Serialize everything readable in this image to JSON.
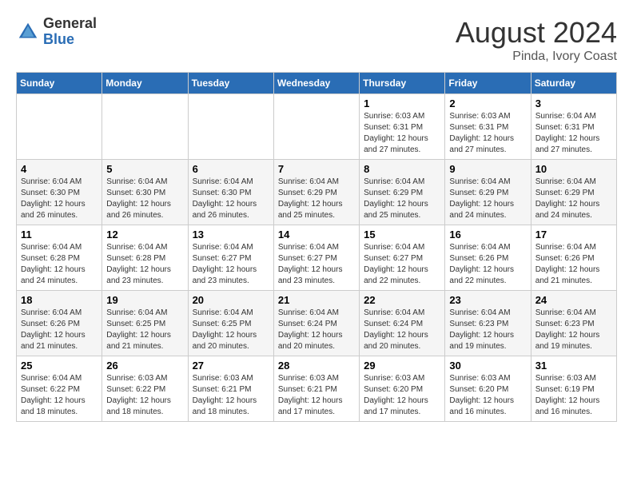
{
  "header": {
    "logo_general": "General",
    "logo_blue": "Blue",
    "month_year": "August 2024",
    "location": "Pinda, Ivory Coast"
  },
  "weekdays": [
    "Sunday",
    "Monday",
    "Tuesday",
    "Wednesday",
    "Thursday",
    "Friday",
    "Saturday"
  ],
  "weeks": [
    [
      {
        "day": "",
        "info": ""
      },
      {
        "day": "",
        "info": ""
      },
      {
        "day": "",
        "info": ""
      },
      {
        "day": "",
        "info": ""
      },
      {
        "day": "1",
        "info": "Sunrise: 6:03 AM\nSunset: 6:31 PM\nDaylight: 12 hours\nand 27 minutes."
      },
      {
        "day": "2",
        "info": "Sunrise: 6:03 AM\nSunset: 6:31 PM\nDaylight: 12 hours\nand 27 minutes."
      },
      {
        "day": "3",
        "info": "Sunrise: 6:04 AM\nSunset: 6:31 PM\nDaylight: 12 hours\nand 27 minutes."
      }
    ],
    [
      {
        "day": "4",
        "info": "Sunrise: 6:04 AM\nSunset: 6:30 PM\nDaylight: 12 hours\nand 26 minutes."
      },
      {
        "day": "5",
        "info": "Sunrise: 6:04 AM\nSunset: 6:30 PM\nDaylight: 12 hours\nand 26 minutes."
      },
      {
        "day": "6",
        "info": "Sunrise: 6:04 AM\nSunset: 6:30 PM\nDaylight: 12 hours\nand 26 minutes."
      },
      {
        "day": "7",
        "info": "Sunrise: 6:04 AM\nSunset: 6:29 PM\nDaylight: 12 hours\nand 25 minutes."
      },
      {
        "day": "8",
        "info": "Sunrise: 6:04 AM\nSunset: 6:29 PM\nDaylight: 12 hours\nand 25 minutes."
      },
      {
        "day": "9",
        "info": "Sunrise: 6:04 AM\nSunset: 6:29 PM\nDaylight: 12 hours\nand 24 minutes."
      },
      {
        "day": "10",
        "info": "Sunrise: 6:04 AM\nSunset: 6:29 PM\nDaylight: 12 hours\nand 24 minutes."
      }
    ],
    [
      {
        "day": "11",
        "info": "Sunrise: 6:04 AM\nSunset: 6:28 PM\nDaylight: 12 hours\nand 24 minutes."
      },
      {
        "day": "12",
        "info": "Sunrise: 6:04 AM\nSunset: 6:28 PM\nDaylight: 12 hours\nand 23 minutes."
      },
      {
        "day": "13",
        "info": "Sunrise: 6:04 AM\nSunset: 6:27 PM\nDaylight: 12 hours\nand 23 minutes."
      },
      {
        "day": "14",
        "info": "Sunrise: 6:04 AM\nSunset: 6:27 PM\nDaylight: 12 hours\nand 23 minutes."
      },
      {
        "day": "15",
        "info": "Sunrise: 6:04 AM\nSunset: 6:27 PM\nDaylight: 12 hours\nand 22 minutes."
      },
      {
        "day": "16",
        "info": "Sunrise: 6:04 AM\nSunset: 6:26 PM\nDaylight: 12 hours\nand 22 minutes."
      },
      {
        "day": "17",
        "info": "Sunrise: 6:04 AM\nSunset: 6:26 PM\nDaylight: 12 hours\nand 21 minutes."
      }
    ],
    [
      {
        "day": "18",
        "info": "Sunrise: 6:04 AM\nSunset: 6:26 PM\nDaylight: 12 hours\nand 21 minutes."
      },
      {
        "day": "19",
        "info": "Sunrise: 6:04 AM\nSunset: 6:25 PM\nDaylight: 12 hours\nand 21 minutes."
      },
      {
        "day": "20",
        "info": "Sunrise: 6:04 AM\nSunset: 6:25 PM\nDaylight: 12 hours\nand 20 minutes."
      },
      {
        "day": "21",
        "info": "Sunrise: 6:04 AM\nSunset: 6:24 PM\nDaylight: 12 hours\nand 20 minutes."
      },
      {
        "day": "22",
        "info": "Sunrise: 6:04 AM\nSunset: 6:24 PM\nDaylight: 12 hours\nand 20 minutes."
      },
      {
        "day": "23",
        "info": "Sunrise: 6:04 AM\nSunset: 6:23 PM\nDaylight: 12 hours\nand 19 minutes."
      },
      {
        "day": "24",
        "info": "Sunrise: 6:04 AM\nSunset: 6:23 PM\nDaylight: 12 hours\nand 19 minutes."
      }
    ],
    [
      {
        "day": "25",
        "info": "Sunrise: 6:04 AM\nSunset: 6:22 PM\nDaylight: 12 hours\nand 18 minutes."
      },
      {
        "day": "26",
        "info": "Sunrise: 6:03 AM\nSunset: 6:22 PM\nDaylight: 12 hours\nand 18 minutes."
      },
      {
        "day": "27",
        "info": "Sunrise: 6:03 AM\nSunset: 6:21 PM\nDaylight: 12 hours\nand 18 minutes."
      },
      {
        "day": "28",
        "info": "Sunrise: 6:03 AM\nSunset: 6:21 PM\nDaylight: 12 hours\nand 17 minutes."
      },
      {
        "day": "29",
        "info": "Sunrise: 6:03 AM\nSunset: 6:20 PM\nDaylight: 12 hours\nand 17 minutes."
      },
      {
        "day": "30",
        "info": "Sunrise: 6:03 AM\nSunset: 6:20 PM\nDaylight: 12 hours\nand 16 minutes."
      },
      {
        "day": "31",
        "info": "Sunrise: 6:03 AM\nSunset: 6:19 PM\nDaylight: 12 hours\nand 16 minutes."
      }
    ]
  ]
}
